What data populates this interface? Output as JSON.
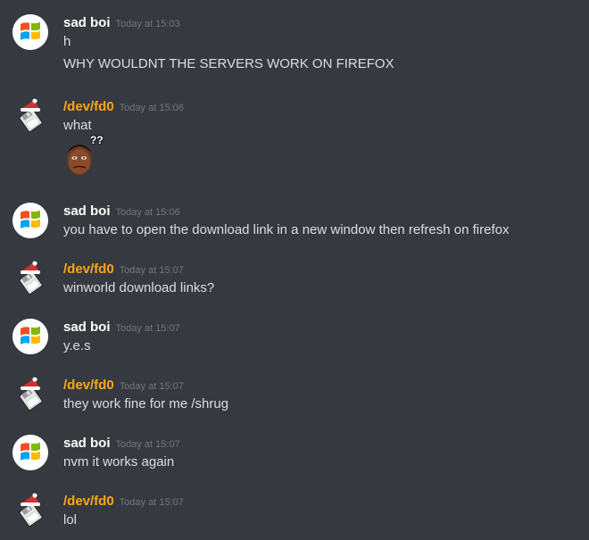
{
  "colors": {
    "background": "#36393f",
    "sad_boi_name": "#ffffff",
    "devfd0_name": "#faa61a",
    "message_text": "#dcddde",
    "timestamp": "#72767d"
  },
  "messages": [
    {
      "author": "sad boi",
      "avatar_icon": "windows-logo-icon",
      "timestamp": "Today at 15:03",
      "lines": [
        "h",
        "WHY WOULDNT THE SERVERS WORK ON FIREFOX"
      ]
    },
    {
      "author": "/dev/fd0",
      "avatar_icon": "floppy-santa-hat-icon",
      "timestamp": "Today at 15:06",
      "lines": [
        "what"
      ],
      "emoji": {
        "icon": "confused-face-emoji-icon",
        "label": "??"
      }
    },
    {
      "author": "sad boi",
      "avatar_icon": "windows-logo-icon",
      "timestamp": "Today at 15:06",
      "lines": [
        "you have to open the download link in a new window then refresh on firefox"
      ]
    },
    {
      "author": "/dev/fd0",
      "avatar_icon": "floppy-santa-hat-icon",
      "timestamp": "Today at 15:07",
      "lines": [
        "winworld download links?"
      ]
    },
    {
      "author": "sad boi",
      "avatar_icon": "windows-logo-icon",
      "timestamp": "Today at 15:07",
      "lines": [
        "y.e.s"
      ]
    },
    {
      "author": "/dev/fd0",
      "avatar_icon": "floppy-santa-hat-icon",
      "timestamp": "Today at 15:07",
      "lines": [
        "they work fine for me /shrug"
      ]
    },
    {
      "author": "sad boi",
      "avatar_icon": "windows-logo-icon",
      "timestamp": "Today at 15:07",
      "lines": [
        "nvm it works again"
      ]
    },
    {
      "author": "/dev/fd0",
      "avatar_icon": "floppy-santa-hat-icon",
      "timestamp": "Today at 15:07",
      "lines": [
        "lol"
      ]
    }
  ]
}
